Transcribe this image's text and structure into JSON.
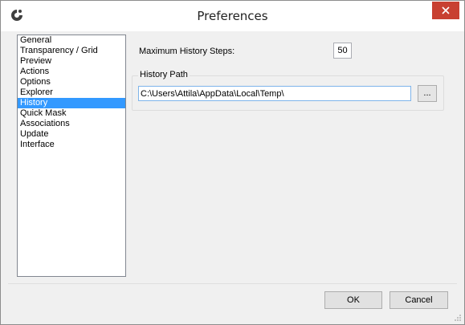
{
  "window": {
    "title": "Preferences",
    "icon": "app-logo-icon"
  },
  "nav": {
    "items": [
      {
        "label": "General"
      },
      {
        "label": "Transparency / Grid"
      },
      {
        "label": "Preview"
      },
      {
        "label": "Actions"
      },
      {
        "label": "Options"
      },
      {
        "label": "Explorer"
      },
      {
        "label": "History"
      },
      {
        "label": "Quick Mask"
      },
      {
        "label": "Associations"
      },
      {
        "label": "Update"
      },
      {
        "label": "Interface"
      }
    ],
    "selected": "History"
  },
  "history": {
    "max_steps_label": "Maximum History Steps:",
    "max_steps_value": "50",
    "path_group_label": "History Path",
    "path_value": "C:\\Users\\Attila\\AppData\\Local\\Temp\\",
    "browse_label": "..."
  },
  "footer": {
    "ok_label": "OK",
    "cancel_label": "Cancel"
  },
  "colors": {
    "selection": "#3399ff",
    "close_button": "#c84031"
  }
}
